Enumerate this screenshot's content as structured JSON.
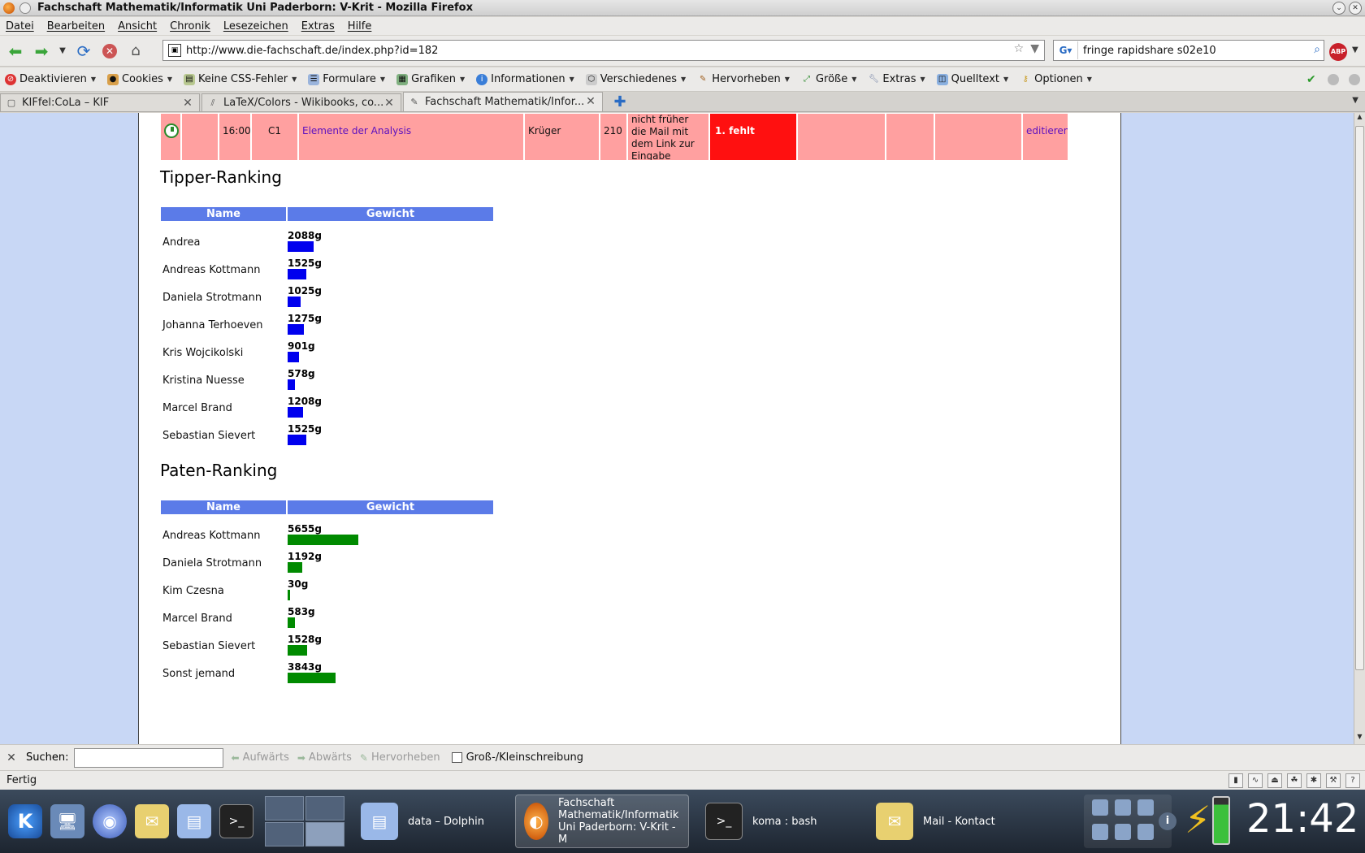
{
  "window": {
    "title": "Fachschaft Mathematik/Informatik Uni Paderborn: V-Krit - Mozilla Firefox"
  },
  "menu": [
    "Datei",
    "Bearbeiten",
    "Ansicht",
    "Chronik",
    "Lesezeichen",
    "Extras",
    "Hilfe"
  ],
  "nav": {
    "url": "http://www.die-fachschaft.de/index.php?id=182",
    "search": "fringe rapidshare s02e10",
    "abp_label": "ABP"
  },
  "devbar": [
    "Deaktivieren",
    "Cookies",
    "Keine CSS-Fehler",
    "Formulare",
    "Grafiken",
    "Informationen",
    "Verschiedenes",
    "Hervorheben",
    "Größe",
    "Extras",
    "Quelltext",
    "Optionen"
  ],
  "tabs": [
    {
      "label": "KIFfel:CoLa – KIF"
    },
    {
      "label": "LaTeX/Colors - Wikibooks, co..."
    },
    {
      "label": "Fachschaft Mathematik/Infor..."
    }
  ],
  "top_row": {
    "time": "16:00",
    "room_code": "C1",
    "course": "Elemente der Analysis",
    "lecturer": "Krüger",
    "number": "210",
    "note": "nicht früher die Mail mit dem Link zur Eingabe bekommen.",
    "status": "1.  fehlt",
    "action": "editieren"
  },
  "tipper_ranking": {
    "title": "Tipper-Ranking",
    "header_name": "Name",
    "header_weight": "Gewicht",
    "bar_color": "#0000ee",
    "rows": [
      {
        "name": "Andrea",
        "weight": "2088g",
        "grams": 2088
      },
      {
        "name": "Andreas Kottmann",
        "weight": "1525g",
        "grams": 1525
      },
      {
        "name": "Daniela Strotmann",
        "weight": "1025g",
        "grams": 1025
      },
      {
        "name": "Johanna Terhoeven",
        "weight": "1275g",
        "grams": 1275
      },
      {
        "name": "Kris Wojcikolski",
        "weight": "901g",
        "grams": 901
      },
      {
        "name": "Kristina Nuesse",
        "weight": "578g",
        "grams": 578
      },
      {
        "name": "Marcel Brand",
        "weight": "1208g",
        "grams": 1208
      },
      {
        "name": "Sebastian Sievert",
        "weight": "1525g",
        "grams": 1525
      }
    ]
  },
  "paten_ranking": {
    "title": "Paten-Ranking",
    "header_name": "Name",
    "header_weight": "Gewicht",
    "bar_color": "#008a00",
    "rows": [
      {
        "name": "Andreas Kottmann",
        "weight": "5655g",
        "grams": 5655
      },
      {
        "name": "Daniela Strotmann",
        "weight": "1192g",
        "grams": 1192
      },
      {
        "name": "Kim Czesna",
        "weight": "30g",
        "grams": 30
      },
      {
        "name": "Marcel Brand",
        "weight": "583g",
        "grams": 583
      },
      {
        "name": "Sebastian Sievert",
        "weight": "1528g",
        "grams": 1528
      },
      {
        "name": "Sonst jemand",
        "weight": "3843g",
        "grams": 3843
      }
    ]
  },
  "findbar": {
    "label": "Suchen:",
    "up": "Aufwärts",
    "down": "Abwärts",
    "highlight": "Hervorheben",
    "case": "Groß-/Kleinschreibung"
  },
  "status": "Fertig",
  "taskbar": {
    "tasks": [
      {
        "label": "data – Dolphin"
      },
      {
        "label": "Fachschaft Mathematik/Informatik Uni Paderborn: V-Krit - M"
      },
      {
        "label": "koma : bash"
      },
      {
        "label": "Mail - Kontact"
      }
    ],
    "clock": "21:42"
  }
}
